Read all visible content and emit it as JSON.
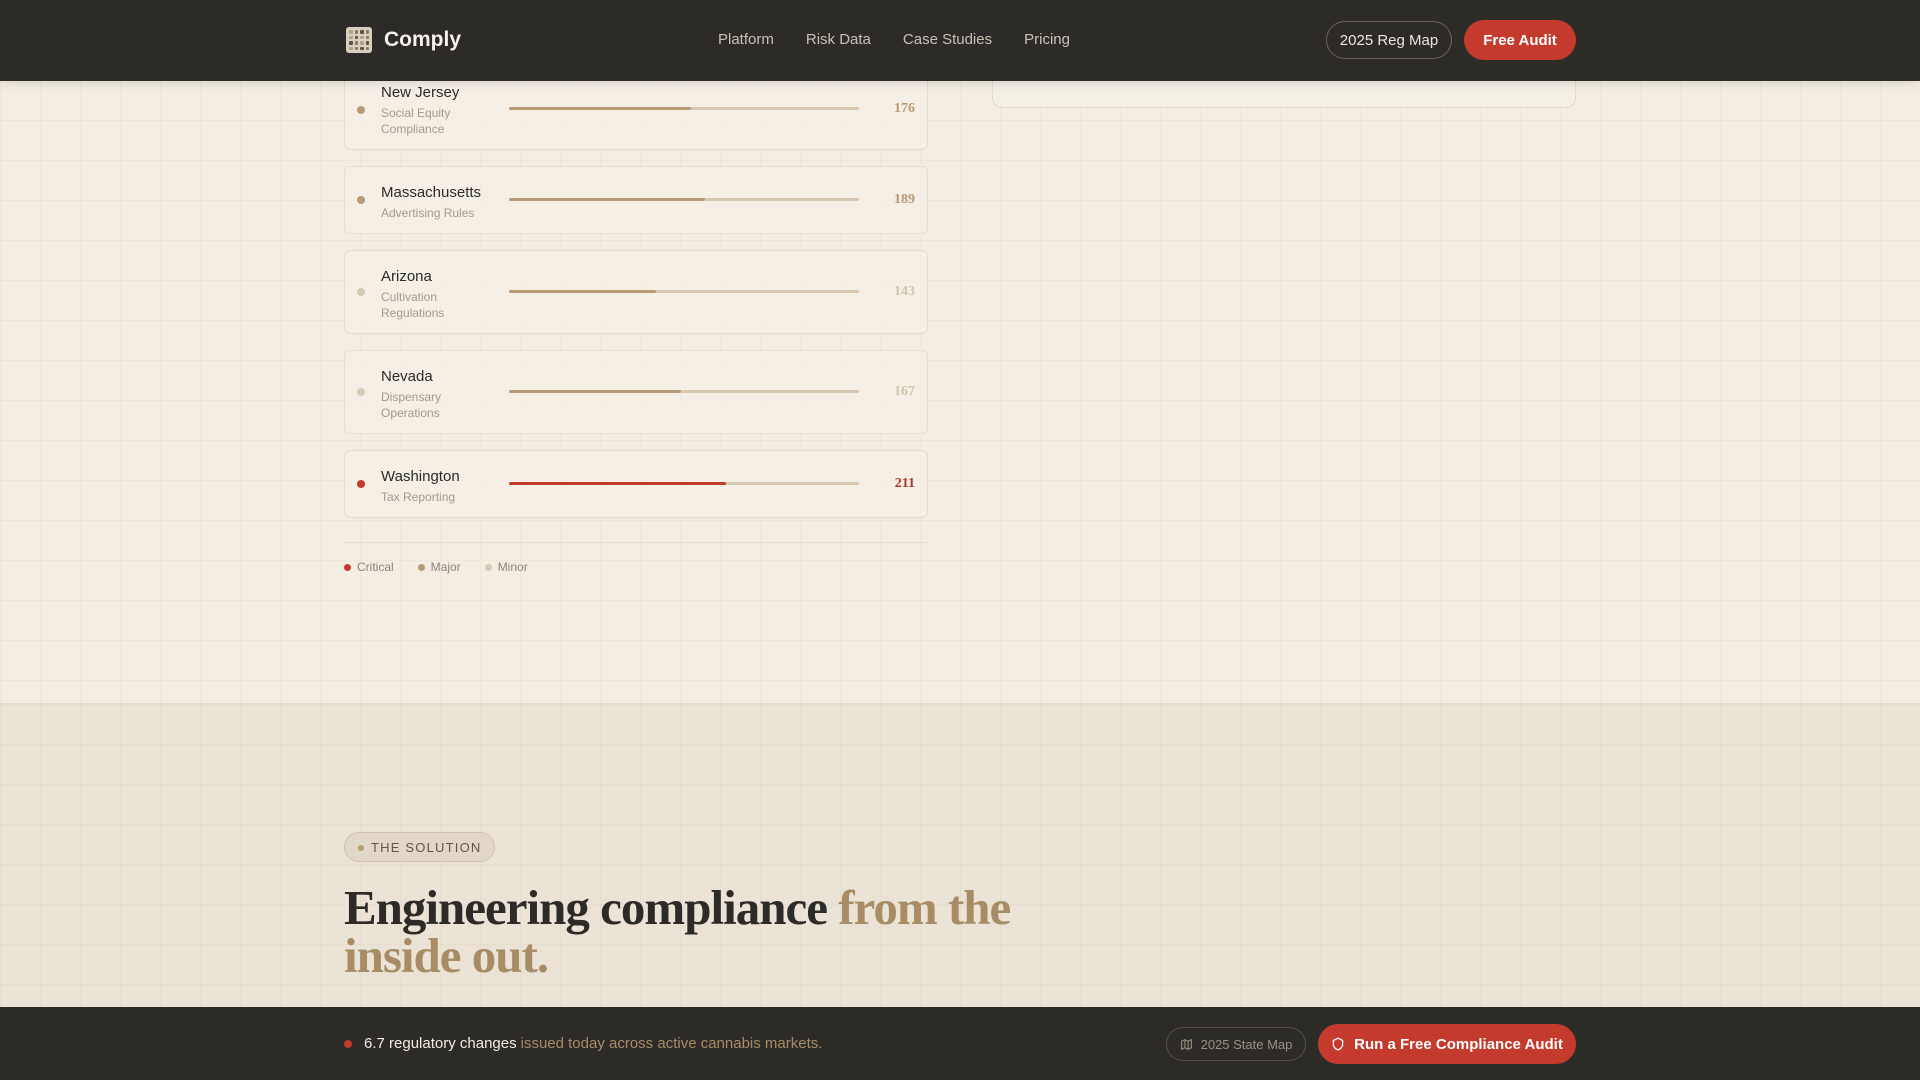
{
  "header": {
    "brand": "Comply",
    "nav": [
      "Platform",
      "Risk Data",
      "Case Studies",
      "Pricing"
    ],
    "reg_map_label": "2025 Reg Map",
    "free_audit_label": "Free Audit"
  },
  "states": [
    {
      "name": "New Jersey",
      "desc": "Social Equity Compliance",
      "count": "176",
      "severity": "major",
      "progress": 0.52
    },
    {
      "name": "Massachusetts",
      "desc": "Advertising Rules",
      "count": "189",
      "severity": "major",
      "progress": 0.56
    },
    {
      "name": "Arizona",
      "desc": "Cultivation Regulations",
      "count": "143",
      "severity": "minor",
      "progress": 0.42
    },
    {
      "name": "Nevada",
      "desc": "Dispensary Operations",
      "count": "167",
      "severity": "minor",
      "progress": 0.49
    },
    {
      "name": "Washington",
      "desc": "Tax Reporting",
      "count": "211",
      "severity": "critical",
      "progress": 0.62
    }
  ],
  "legend": [
    {
      "label": "Critical",
      "severity": "critical"
    },
    {
      "label": "Major",
      "severity": "major"
    },
    {
      "label": "Minor",
      "severity": "minor"
    }
  ],
  "colors": {
    "critical": "#c43a2c",
    "major": "#b89b75",
    "minor": "#d6c9b4",
    "critical_text": "#b0352a",
    "major_text": "#b89b75",
    "minor_text": "#d1c4ae"
  },
  "solution": {
    "eyebrow": "THE SOLUTION",
    "headline_main": "Engineering compliance ",
    "headline_accent": "from the inside out."
  },
  "footer": {
    "ticker_strong": "6.7 regulatory changes",
    "ticker_muted": "issued today across active cannabis markets.",
    "state_map_label": "2025 State Map",
    "audit_cta_label": "Run a Free Compliance Audit"
  }
}
